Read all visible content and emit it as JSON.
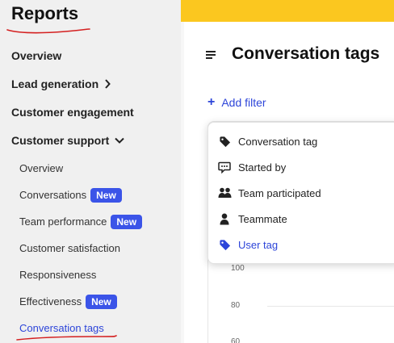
{
  "sidebar": {
    "title": "Reports",
    "items": [
      {
        "label": "Overview"
      },
      {
        "label": "Lead generation"
      },
      {
        "label": "Customer engagement"
      },
      {
        "label": "Customer support"
      }
    ],
    "sub_items": [
      {
        "label": "Overview"
      },
      {
        "label": "Conversations",
        "badge": "New"
      },
      {
        "label": "Team performance",
        "badge": "New"
      },
      {
        "label": "Customer satisfaction"
      },
      {
        "label": "Responsiveness"
      },
      {
        "label": "Effectiveness",
        "badge": "New"
      },
      {
        "label": "Conversation tags"
      }
    ]
  },
  "main": {
    "page_title": "Conversation tags",
    "add_filter_label": "Add filter",
    "chart_ticks": [
      "100",
      "80",
      "60"
    ]
  },
  "dropdown": {
    "items": [
      {
        "label": "Conversation tag",
        "icon": "tag-icon"
      },
      {
        "label": "Started by",
        "icon": "chat-bubble-icon"
      },
      {
        "label": "Team participated",
        "icon": "people-icon"
      },
      {
        "label": "Teammate",
        "icon": "person-icon"
      },
      {
        "label": "User tag",
        "icon": "tag-icon"
      }
    ]
  },
  "colors": {
    "accent": "#2d45d9",
    "badge": "#3b54e8",
    "topbar": "#fbc71f",
    "annotation": "#d42020"
  }
}
